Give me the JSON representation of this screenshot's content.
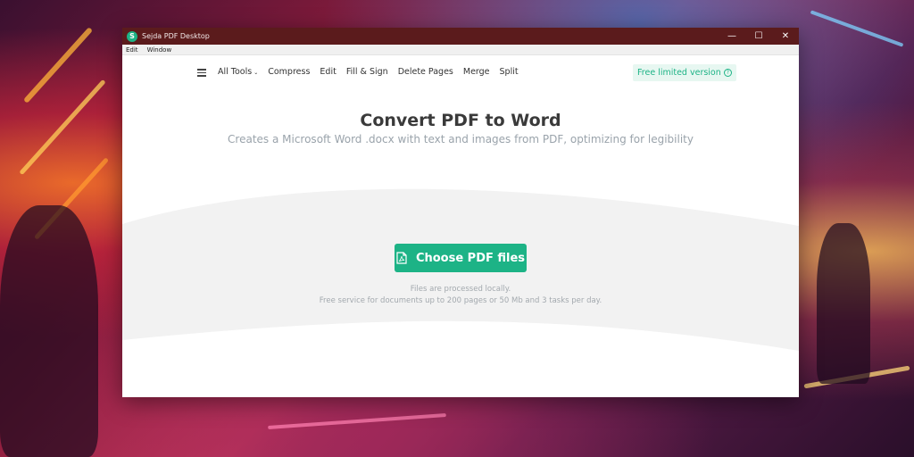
{
  "window": {
    "title": "Sejda PDF Desktop",
    "logo_letter": "S",
    "controls": {
      "minimize": "—",
      "maximize": "☐",
      "close": "✕"
    }
  },
  "menubar": {
    "items": [
      "Edit",
      "Window"
    ]
  },
  "nav": {
    "links": [
      "All Tools",
      "Compress",
      "Edit",
      "Fill & Sign",
      "Delete Pages",
      "Merge",
      "Split"
    ],
    "badge": "Free limited version",
    "help_glyph": "?"
  },
  "main": {
    "heading": "Convert PDF to Word",
    "subheading": "Creates a Microsoft Word .docx with text and images from PDF, optimizing for legibility",
    "button_label": "Choose PDF files",
    "note_line1": "Files are processed locally.",
    "note_line2": "Free service for documents up to 200 pages or 50 Mb and 3 tasks per day."
  },
  "colors": {
    "accent": "#1db386",
    "titlebar": "#5b1b1c"
  }
}
